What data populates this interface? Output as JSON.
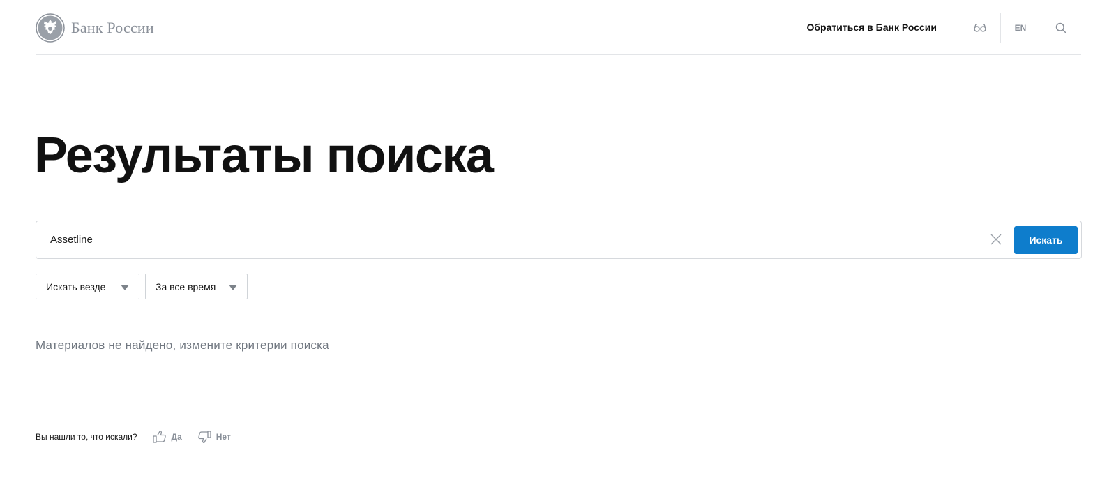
{
  "header": {
    "logo_text": "Банк России",
    "logo_icon": "double-headed-eagle-emblem",
    "contact_link": "Обратиться в Банк России",
    "accessibility_icon": "glasses-icon",
    "language": "EN",
    "search_icon": "search-icon"
  },
  "page": {
    "title": "Результаты поиска"
  },
  "search": {
    "value": "Assetline",
    "placeholder": "",
    "clear_icon": "close-icon",
    "button_label": "Искать"
  },
  "filters": {
    "scope": "Искать везде",
    "period": "За все время"
  },
  "results": {
    "empty_message": "Материалов не найдено, измените критерии поиска"
  },
  "feedback": {
    "question": "Вы нашли то, что искали?",
    "yes": "Да",
    "no": "Нет"
  },
  "colors": {
    "accent": "#0e7dcc",
    "muted_text": "#8a9099",
    "border": "#e3e5e8"
  }
}
